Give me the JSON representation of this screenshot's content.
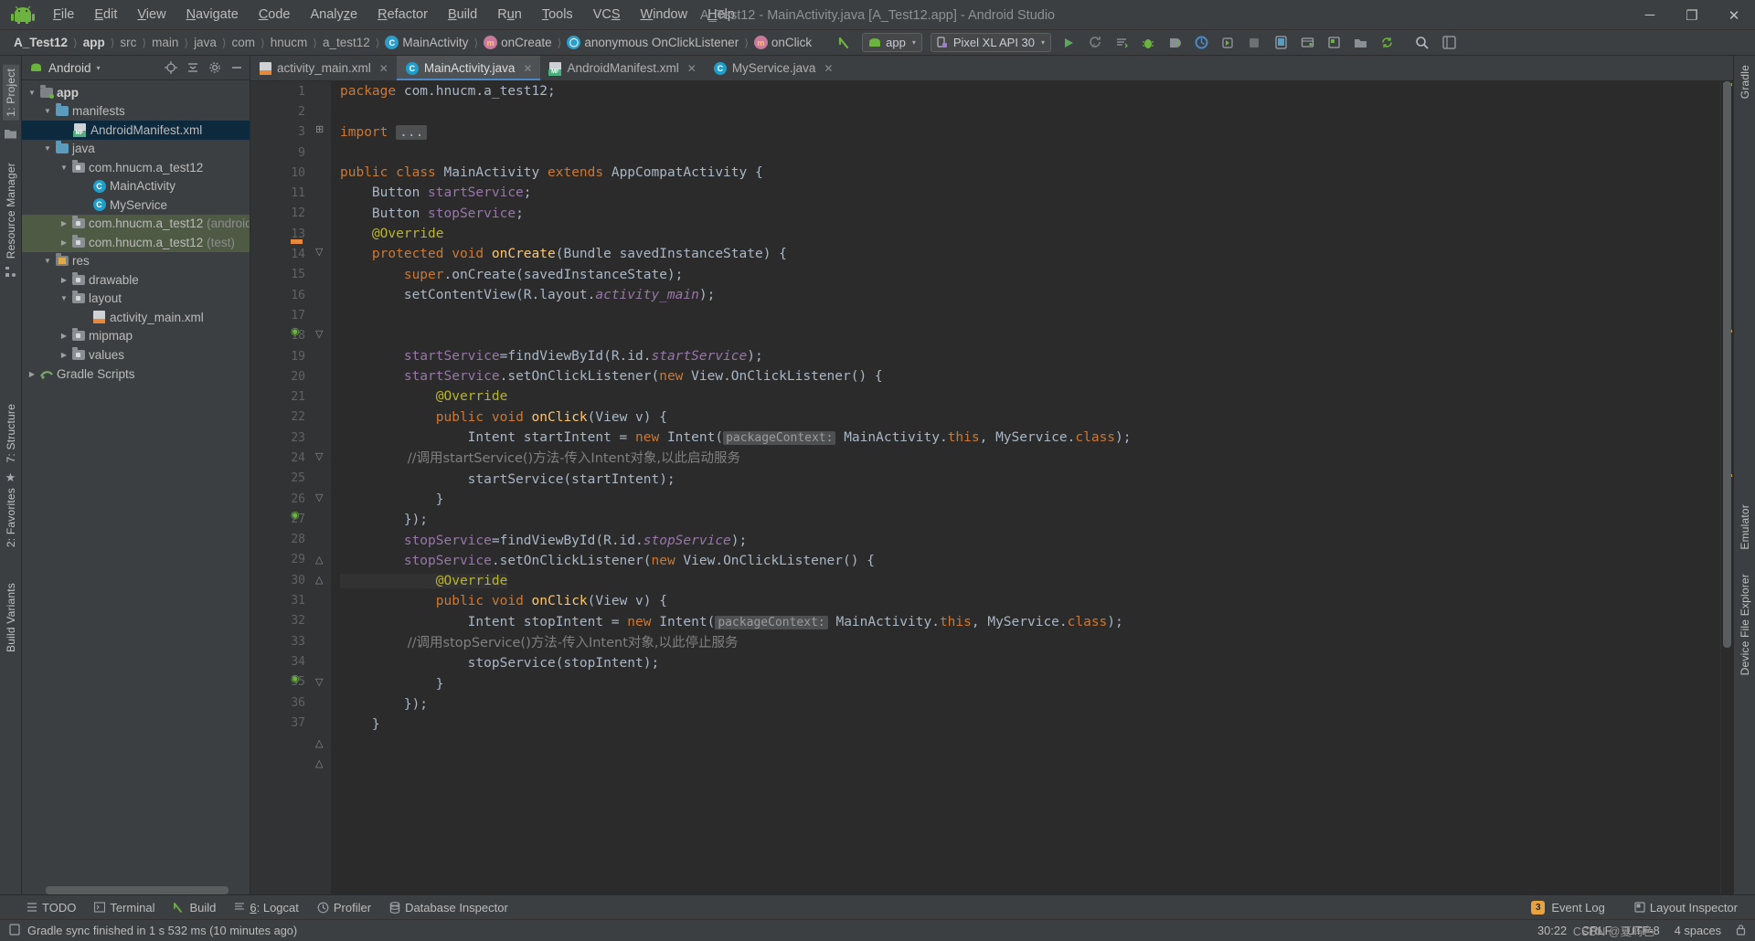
{
  "window": {
    "title": "A_Test12 - MainActivity.java [A_Test12.app] - Android Studio",
    "minimize": "─",
    "maximize": "❐",
    "close": "✕"
  },
  "menu": {
    "items": [
      {
        "label": "File",
        "mnemonic": "F"
      },
      {
        "label": "Edit",
        "mnemonic": "E"
      },
      {
        "label": "View",
        "mnemonic": "V"
      },
      {
        "label": "Navigate",
        "mnemonic": "N"
      },
      {
        "label": "Code",
        "mnemonic": "C"
      },
      {
        "label": "Analyze",
        "mnemonic": "z"
      },
      {
        "label": "Refactor",
        "mnemonic": "R"
      },
      {
        "label": "Build",
        "mnemonic": "B"
      },
      {
        "label": "Run",
        "mnemonic": "u"
      },
      {
        "label": "Tools",
        "mnemonic": "T"
      },
      {
        "label": "VCS",
        "mnemonic": "S"
      },
      {
        "label": "Window",
        "mnemonic": "W"
      },
      {
        "label": "Help",
        "mnemonic": "H"
      }
    ]
  },
  "breadcrumbs": [
    {
      "label": "A_Test12",
      "kind": "bold"
    },
    {
      "label": "app",
      "kind": "bold"
    },
    {
      "label": "src",
      "kind": "dim"
    },
    {
      "label": "main",
      "kind": "dim"
    },
    {
      "label": "java",
      "kind": "dim"
    },
    {
      "label": "com",
      "kind": "dim"
    },
    {
      "label": "hnucm",
      "kind": "dim"
    },
    {
      "label": "a_test12",
      "kind": "dim"
    },
    {
      "label": "MainActivity",
      "kind": "class",
      "icon": "class-icon",
      "glyph": "C"
    },
    {
      "label": "onCreate",
      "kind": "method",
      "icon": "method-icon",
      "glyph": "m"
    },
    {
      "label": "anonymous OnClickListener",
      "kind": "anon",
      "icon": "class-icon",
      "glyph": "○"
    },
    {
      "label": "onClick",
      "kind": "method",
      "icon": "method-icon",
      "glyph": "m"
    }
  ],
  "toolbar": {
    "module_selector": "app",
    "device_selector": "Pixel XL API 30",
    "caret": "▾",
    "icons": [
      "run-icon",
      "rerun-icon",
      "sync-icon",
      "debug-icon",
      "profile-icon",
      "coverage-icon",
      "apply-changes-icon",
      "stop-icon",
      "avd-manager-icon",
      "sdk-manager-icon",
      "layout-inspector-icon",
      "device-explorer-icon",
      "sync-project-icon",
      "search-icon",
      "settings-icon"
    ]
  },
  "left_rail": {
    "labels": [
      "1: Project",
      "Resource Manager",
      "7: Structure",
      "2: Favorites",
      "Build Variants"
    ]
  },
  "right_rail": {
    "labels": [
      "Gradle",
      "Emulator",
      "Device File Explorer"
    ]
  },
  "project_panel": {
    "selector": "Android",
    "caret": "▾",
    "header_icons": [
      "locate-icon",
      "collapse-all-icon",
      "settings-icon",
      "hide-icon"
    ],
    "tree": [
      {
        "depth": 0,
        "label": "app",
        "arrow": "▼",
        "icon": "module-folder-icon",
        "style": "bold"
      },
      {
        "depth": 1,
        "label": "manifests",
        "arrow": "▼",
        "icon": "folder-blue-icon",
        "style": ""
      },
      {
        "depth": 2,
        "label": "AndroidManifest.xml",
        "arrow": "",
        "icon": "manifest-file-icon",
        "style": "selected"
      },
      {
        "depth": 1,
        "label": "java",
        "arrow": "▼",
        "icon": "folder-blue-icon",
        "style": ""
      },
      {
        "depth": 2,
        "label": "com.hnucm.a_test12",
        "arrow": "▼",
        "icon": "package-icon",
        "style": ""
      },
      {
        "depth": 3,
        "label": "MainActivity",
        "arrow": "",
        "icon": "java-class-icon",
        "style": ""
      },
      {
        "depth": 3,
        "label": "MyService",
        "arrow": "",
        "icon": "java-class-icon",
        "style": ""
      },
      {
        "depth": 2,
        "label": "com.hnucm.a_test12",
        "suffix": " (androidTest)",
        "arrow": "▶",
        "icon": "package-icon",
        "style": "scope"
      },
      {
        "depth": 2,
        "label": "com.hnucm.a_test12",
        "suffix": " (test)",
        "arrow": "▶",
        "icon": "package-icon",
        "style": "scope"
      },
      {
        "depth": 1,
        "label": "res",
        "arrow": "▼",
        "icon": "res-folder-icon",
        "style": ""
      },
      {
        "depth": 2,
        "label": "drawable",
        "arrow": "▶",
        "icon": "package-icon",
        "style": ""
      },
      {
        "depth": 2,
        "label": "layout",
        "arrow": "▼",
        "icon": "package-icon",
        "style": ""
      },
      {
        "depth": 3,
        "label": "activity_main.xml",
        "arrow": "",
        "icon": "xml-file-icon",
        "style": ""
      },
      {
        "depth": 2,
        "label": "mipmap",
        "arrow": "▶",
        "icon": "package-icon",
        "style": ""
      },
      {
        "depth": 2,
        "label": "values",
        "arrow": "▶",
        "icon": "package-icon",
        "style": ""
      },
      {
        "depth": 0,
        "label": "Gradle Scripts",
        "arrow": "▶",
        "icon": "gradle-icon",
        "style": ""
      }
    ]
  },
  "editor_tabs": [
    {
      "label": "activity_main.xml",
      "icon": "xml-file-icon",
      "active": false,
      "close": "✕"
    },
    {
      "label": "MainActivity.java",
      "icon": "java-class-icon",
      "active": true,
      "close": "✕"
    },
    {
      "label": "AndroidManifest.xml",
      "icon": "manifest-file-icon",
      "active": false,
      "close": "✕"
    },
    {
      "label": "MyService.java",
      "icon": "java-class-icon",
      "active": false,
      "close": "✕"
    }
  ],
  "code": {
    "line_numbers": [
      1,
      2,
      3,
      9,
      10,
      11,
      12,
      13,
      14,
      15,
      16,
      17,
      18,
      19,
      20,
      21,
      22,
      23,
      24,
      25,
      26,
      27,
      28,
      29,
      30,
      31,
      32,
      33,
      34,
      35,
      36,
      37
    ],
    "current_line": 30,
    "lines": [
      "package com.hnucm.a_test12;",
      "",
      "import ...",
      "",
      "public class MainActivity extends AppCompatActivity {",
      "    Button startService;",
      "    Button stopService;",
      "    @Override",
      "    protected void onCreate(Bundle savedInstanceState) {",
      "        super.onCreate(savedInstanceState);",
      "        setContentView(R.layout.activity_main);",
      "",
      "",
      "        startService=findViewById(R.id.startService);",
      "        startService.setOnClickListener(new View.OnClickListener() {",
      "            @Override",
      "            public void onClick(View v) {",
      "                Intent startIntent = new Intent( packageContext: MainActivity.this, MyService.class);",
      "                //调用startService()方法-传入Intent对象,以此启动服务",
      "                startService(startIntent);",
      "            }",
      "        });",
      "        stopService=findViewById(R.id.stopService);",
      "        stopService.setOnClickListener(new View.OnClickListener() {",
      "            @Override",
      "            public void onClick(View v) {",
      "                Intent stopIntent = new Intent( packageContext: MainActivity.this, MyService.class);",
      "                //调用stopService()方法-传入Intent对象,以此停止服务",
      "                stopService(stopIntent);",
      "            }",
      "        });",
      "    }"
    ],
    "param_hints": [
      "packageContext:"
    ]
  },
  "bottom_tools": [
    {
      "label": "TODO",
      "icon": "todo-icon",
      "mnemonic": ""
    },
    {
      "label": "Terminal",
      "icon": "terminal-icon",
      "mnemonic": ""
    },
    {
      "label": "Build",
      "icon": "build-icon",
      "mnemonic": ""
    },
    {
      "label": "6: Logcat",
      "icon": "logcat-icon",
      "mnemonic": "6"
    },
    {
      "label": "Profiler",
      "icon": "profiler-icon",
      "mnemonic": ""
    },
    {
      "label": "Database Inspector",
      "icon": "database-icon",
      "mnemonic": ""
    }
  ],
  "bottom_right": [
    {
      "label": "Event Log",
      "icon": "event-log-icon",
      "badge": "3"
    },
    {
      "label": "Layout Inspector",
      "icon": "layout-inspector-icon",
      "badge": ""
    }
  ],
  "status": {
    "message": "Gradle sync finished in 1 s 532 ms (10 minutes ago)",
    "caret": "30:22",
    "line_separator": "CRLF",
    "encoding": "UTF-8",
    "indent": "4 spaces",
    "watermark": "CSDN @夏屿色"
  },
  "colors": {
    "accent": "#4a88c7",
    "selection": "#0d293e",
    "scope_test": "#4e5a44",
    "editor_bg": "#2b2b2b",
    "panel_bg": "#3c3f41",
    "keyword": "#cc7832",
    "field": "#9876aa",
    "method": "#ffc66d",
    "comment": "#808080",
    "annotation": "#bbb529",
    "green_run": "#5ba85b",
    "android_green": "#6cb33f"
  }
}
